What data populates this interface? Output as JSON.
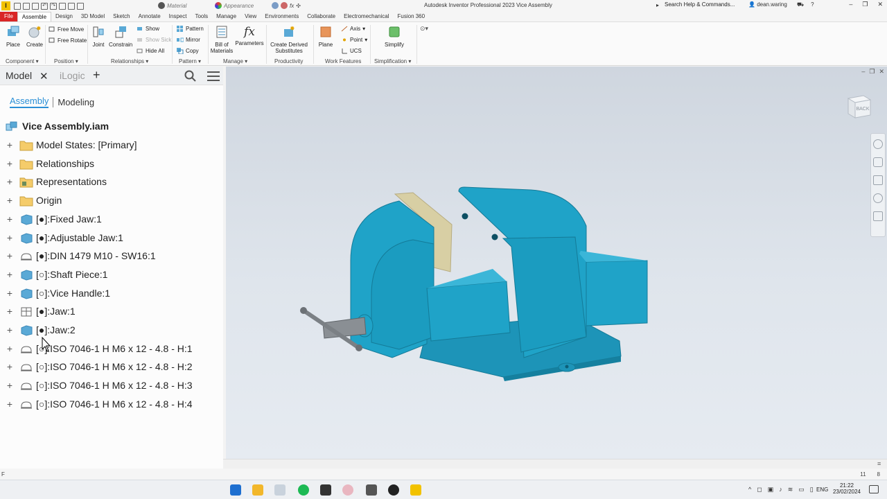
{
  "titlebar": {
    "logo": "I",
    "material_placeholder": "Material",
    "appearance_placeholder": "Appearance",
    "app_title": "Autodesk Inventor Professional 2023   Vice Assembly",
    "search_text": "Search Help & Commands...",
    "user": "dean.waring"
  },
  "menu": {
    "tabs": [
      "File",
      "Assemble",
      "Design",
      "3D Model",
      "Sketch",
      "Annotate",
      "Inspect",
      "Tools",
      "Manage",
      "View",
      "Environments",
      "Collaborate",
      "Electromechanical",
      "Fusion 360"
    ],
    "active": "Assemble"
  },
  "ribbon": {
    "place": "Place",
    "create": "Create",
    "free_move": "Free Move",
    "free_rotate": "Free Rotate",
    "joint": "Joint",
    "constrain": "Constrain",
    "show": "Show",
    "show_sick": "Show Sick",
    "hide_all": "Hide All",
    "pattern": "Pattern",
    "mirror": "Mirror",
    "copy": "Copy",
    "bom_line1": "Bill of",
    "bom_line2": "Materials",
    "parameters": "Parameters",
    "cds_line1": "Create Derived",
    "cds_line2": "Substitutes",
    "plane": "Plane",
    "axis": "Axis",
    "point": "Point",
    "ucs": "UCS",
    "simplify": "Simplify",
    "groups": {
      "component": "Component",
      "position": "Position",
      "relationships": "Relationships",
      "pattern": "Pattern",
      "manage": "Manage",
      "productivity": "Productivity",
      "work_features": "Work Features",
      "simplification": "Simplification"
    }
  },
  "browser": {
    "tab_model": "Model",
    "tab_ilogic": "iLogic",
    "subtab_assembly": "Assembly",
    "subtab_modeling": "Modeling",
    "root": "Vice Assembly.iam",
    "nodes": [
      {
        "label": "Model States: [Primary]",
        "icon": "folder-icon"
      },
      {
        "label": "Relationships",
        "icon": "folder-icon"
      },
      {
        "label": "Representations",
        "icon": "representations-folder-icon"
      },
      {
        "label": "Origin",
        "icon": "folder-icon"
      },
      {
        "label": "[●]:Fixed Jaw:1",
        "icon": "part-icon"
      },
      {
        "label": "[●]:Adjustable Jaw:1",
        "icon": "part-icon"
      },
      {
        "label": "[●]:DIN 1479 M10 - SW16:1",
        "icon": "fastener-icon"
      },
      {
        "label": "[○]:Shaft Piece:1",
        "icon": "part-icon"
      },
      {
        "label": "[○]:Vice Handle:1",
        "icon": "part-icon"
      },
      {
        "label": "[●]:Jaw:1",
        "icon": "wireframe-part-icon"
      },
      {
        "label": "[●]:Jaw:2",
        "icon": "part-icon"
      },
      {
        "label": "[○]:ISO 7046-1 H M6 x 12 - 4.8 - H:1",
        "icon": "fastener-icon"
      },
      {
        "label": "[○]:ISO 7046-1 H M6 x 12 - 4.8 - H:2",
        "icon": "fastener-icon"
      },
      {
        "label": "[○]:ISO 7046-1 H M6 x 12 - 4.8 - H:3",
        "icon": "fastener-icon"
      },
      {
        "label": "[○]:ISO 7046-1 H M6 x 12 - 4.8 - H:4",
        "icon": "fastener-icon"
      }
    ]
  },
  "viewport": {
    "viewcube_label": "BACK"
  },
  "status": {
    "left": "F",
    "count1": "11",
    "count2": "8"
  },
  "taskbar": {
    "language": "ENG",
    "time": "21:22",
    "date": "23/02/2024"
  },
  "colors": {
    "accent": "#2a8fd6",
    "file_tab": "#d92626",
    "vise_body": "#1fa3c8",
    "jaw_plate": "#d8cfa4"
  }
}
